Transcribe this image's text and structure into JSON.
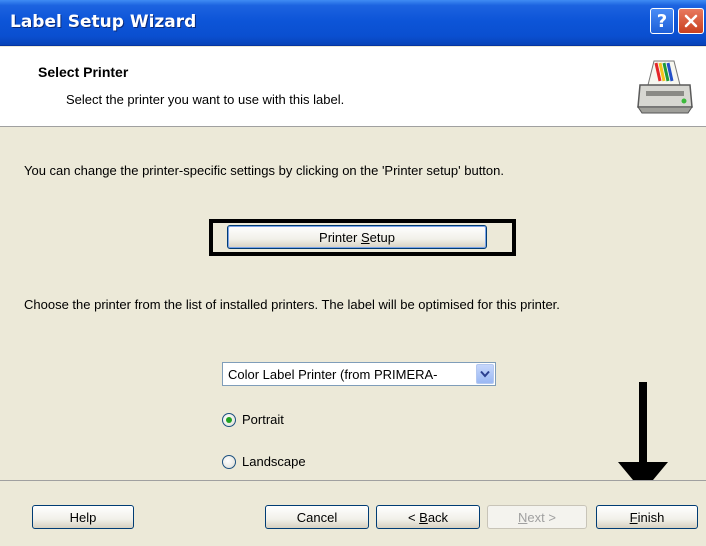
{
  "window": {
    "title": "Label Setup Wizard",
    "help_glyph": "?",
    "colors": {
      "titlebar": "#0a4fd0",
      "close": "#c9401f",
      "body": "#ece9d8"
    }
  },
  "header": {
    "title": "Select Printer",
    "subtitle": "Select the printer you want to use with this label.",
    "icon": "printer-icon"
  },
  "body": {
    "intro_text": "You can change the printer-specific settings by clicking on the 'Printer setup' button.",
    "printer_setup_prefix": "Printer ",
    "printer_setup_accel": "S",
    "printer_setup_suffix": "etup",
    "choose_text": "Choose the printer from the list of installed printers. The label will be optimised for this printer.",
    "printer_select_value": "Color Label Printer (from PRIMERA-",
    "orientation": {
      "portrait_label": "Portrait",
      "landscape_label": "Landscape",
      "selected": "Portrait"
    }
  },
  "footer": {
    "help_label": "Help",
    "cancel_label": "Cancel",
    "back_prefix": "< ",
    "back_accel": "B",
    "back_suffix": "ack",
    "next_prefix": "",
    "next_accel": "N",
    "next_suffix": "ext >",
    "finish_accel": "F",
    "finish_suffix": "inish"
  }
}
